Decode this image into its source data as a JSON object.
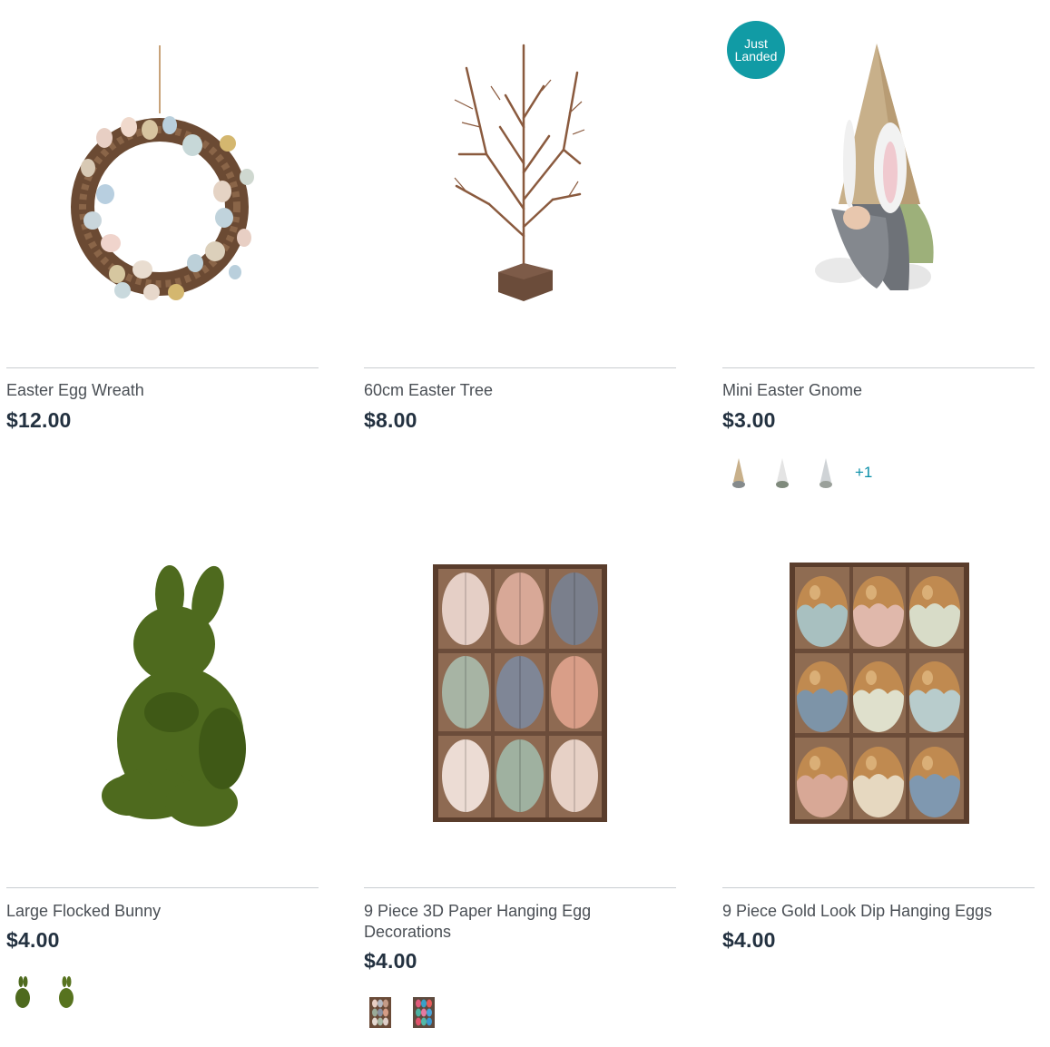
{
  "products": [
    {
      "name": "Easter Egg Wreath",
      "price": "$12.00",
      "image_icon": "easter-egg-wreath-image"
    },
    {
      "name": "60cm Easter Tree",
      "price": "$8.00",
      "image_icon": "easter-tree-image"
    },
    {
      "name": "Mini Easter Gnome",
      "price": "$3.00",
      "badge": "Just Landed",
      "more_colours": "+1",
      "image_icon": "easter-gnome-image"
    },
    {
      "name": "Large Flocked Bunny",
      "price": "$4.00",
      "image_icon": "flocked-bunny-image"
    },
    {
      "name": "9 Piece 3D Paper Hanging Egg Decorations",
      "price": "$4.00",
      "image_icon": "paper-hanging-eggs-image"
    },
    {
      "name": "9 Piece Gold Look Dip Hanging Eggs",
      "price": "$4.00",
      "image_icon": "gold-dip-eggs-image"
    }
  ],
  "colors": {
    "badge": "#119ba5",
    "price": "#233140",
    "link": "#0a8fa8",
    "divider": "#c9cdd1"
  }
}
